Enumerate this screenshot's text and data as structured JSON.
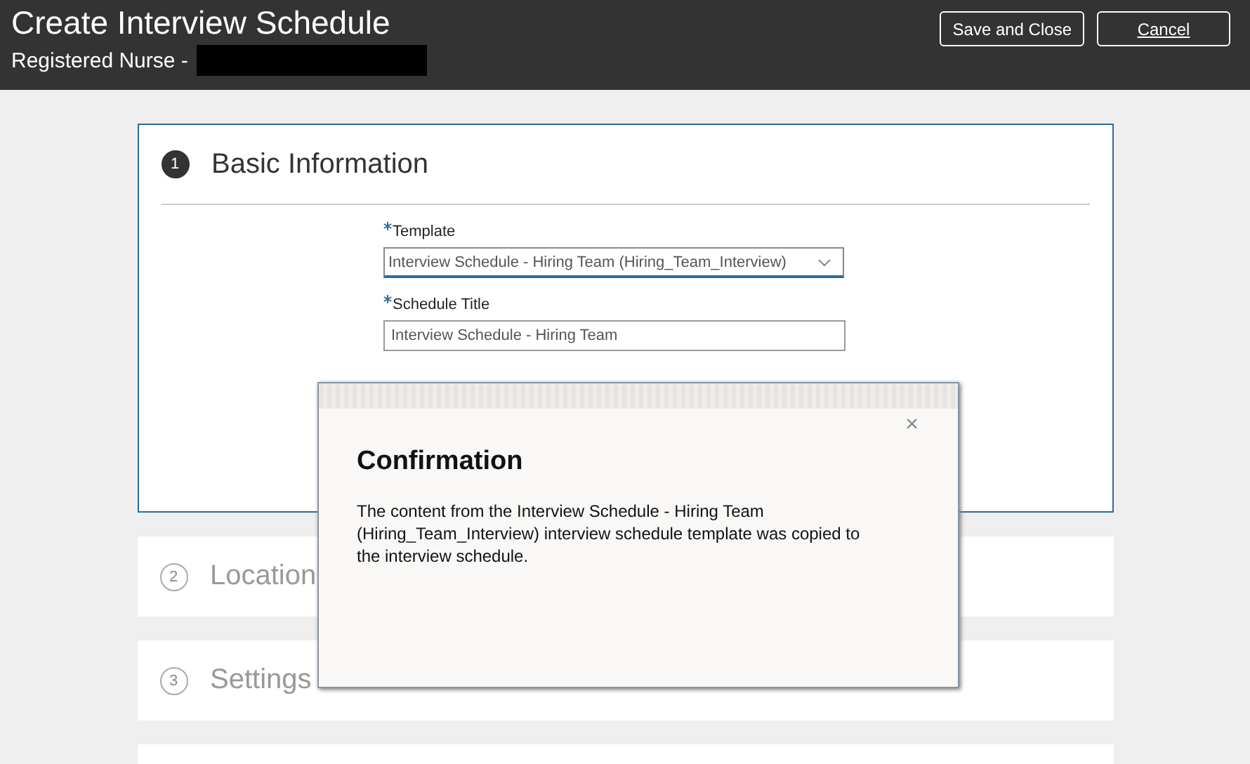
{
  "header": {
    "title": "Create Interview Schedule",
    "subtitle": "Registered Nurse -",
    "buttons": [
      {
        "label": "Save and Close",
        "kind": "plain"
      },
      {
        "label": "Cancel",
        "kind": "access"
      }
    ]
  },
  "steps": [
    {
      "number": "1",
      "title": "Basic Information",
      "selected": true,
      "fields": [
        {
          "label": "Template",
          "required": true,
          "kind": "select",
          "value": "Interview Schedule - Hiring Team (Hiring_Team_Interview)"
        },
        {
          "label": "Schedule Title",
          "required": true,
          "kind": "text",
          "value": "Interview Schedule - Hiring Team"
        }
      ]
    },
    {
      "number": "2",
      "title": "Location",
      "selected": false
    },
    {
      "number": "3",
      "title": "Settings",
      "selected": false
    },
    {
      "selected": false
    }
  ],
  "dialog": {
    "title": "Confirmation",
    "message": "The content from the Interview Schedule - Hiring Team (Hiring_Team_Interview) interview schedule template was copied to the interview schedule.",
    "close": "×"
  }
}
